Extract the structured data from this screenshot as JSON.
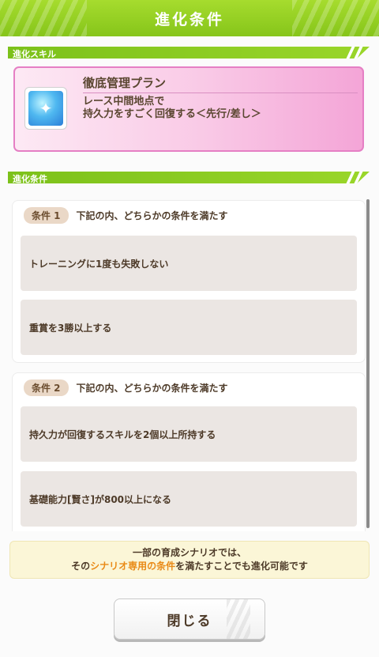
{
  "header": {
    "title": "進化条件"
  },
  "skill_section": {
    "label": "進化スキル"
  },
  "skill": {
    "name": "徹底管理プラン",
    "desc_line1": "レース中間地点で",
    "desc_line2": "持久力をすごく回復する＜先行/差し＞",
    "icon": "sparkle-icon"
  },
  "condition_section": {
    "label": "進化条件"
  },
  "conditions": [
    {
      "badge": "条件 1",
      "title": "下記の内、どちらかの条件を満たす",
      "items": [
        "トレーニングに1度も失敗しない",
        "重賞を3勝以上する"
      ]
    },
    {
      "badge": "条件 2",
      "title": "下記の内、どちらかの条件を満たす",
      "items": [
        "持久力が回復するスキルを2個以上所持する",
        "基礎能力[賢さ]が800以上になる"
      ]
    }
  ],
  "notice": {
    "line1": "一部の育成シナリオでは、",
    "line2_prefix": "その",
    "line2_highlight": "シナリオ専用の条件",
    "line2_suffix": "を満たすことでも進化可能です"
  },
  "close_button": {
    "label": "閉じる"
  },
  "colors": {
    "header_green": "#8fcb1f",
    "skill_pink": "#f4a5d7",
    "highlight_orange": "#e98a17"
  }
}
